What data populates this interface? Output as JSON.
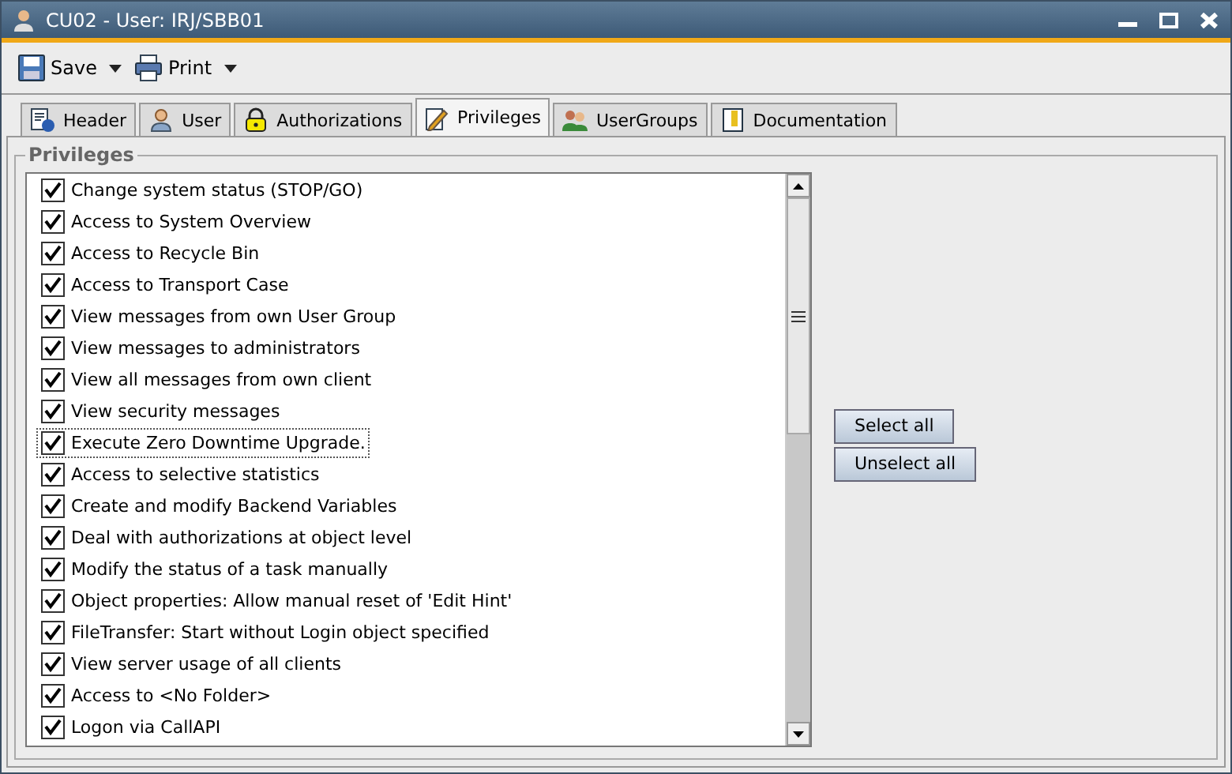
{
  "window": {
    "title": "CU02 - User: IRJ/SBB01"
  },
  "toolbar": [
    {
      "label": "Save",
      "kind": "save"
    },
    {
      "label": "Print",
      "kind": "print"
    }
  ],
  "tabs": [
    {
      "label": "Header",
      "kind": "header",
      "selected": false
    },
    {
      "label": "User",
      "kind": "user",
      "selected": false
    },
    {
      "label": "Authorizations",
      "kind": "lock",
      "selected": false
    },
    {
      "label": "Privileges",
      "kind": "pen",
      "selected": true
    },
    {
      "label": "UserGroups",
      "kind": "group",
      "selected": false
    },
    {
      "label": "Documentation",
      "kind": "doc",
      "selected": false
    }
  ],
  "group": {
    "title": "Privileges"
  },
  "privileges": [
    {
      "label": "Change system status (STOP/GO)",
      "checked": true,
      "focused": false
    },
    {
      "label": "Access to System Overview",
      "checked": true,
      "focused": false
    },
    {
      "label": "Access to Recycle Bin",
      "checked": true,
      "focused": false
    },
    {
      "label": "Access to Transport Case",
      "checked": true,
      "focused": false
    },
    {
      "label": "View messages from own User Group",
      "checked": true,
      "focused": false
    },
    {
      "label": "View messages to administrators",
      "checked": true,
      "focused": false
    },
    {
      "label": "View all messages from own client",
      "checked": true,
      "focused": false
    },
    {
      "label": "View security messages",
      "checked": true,
      "focused": false
    },
    {
      "label": "Execute Zero Downtime Upgrade.",
      "checked": true,
      "focused": true
    },
    {
      "label": "Access to selective statistics",
      "checked": true,
      "focused": false
    },
    {
      "label": "Create and modify Backend Variables",
      "checked": true,
      "focused": false
    },
    {
      "label": "Deal with authorizations at object level",
      "checked": true,
      "focused": false
    },
    {
      "label": "Modify the status of a task manually",
      "checked": true,
      "focused": false
    },
    {
      "label": "Object properties: Allow manual reset of 'Edit Hint'",
      "checked": true,
      "focused": false
    },
    {
      "label": "FileTransfer: Start without Login object specified",
      "checked": true,
      "focused": false
    },
    {
      "label": "View server usage of all clients",
      "checked": true,
      "focused": false
    },
    {
      "label": "Access to <No Folder>",
      "checked": true,
      "focused": false
    },
    {
      "label": "Logon via CallAPI",
      "checked": true,
      "focused": false
    }
  ],
  "buttons": [
    "Select all",
    "Unselect all"
  ]
}
